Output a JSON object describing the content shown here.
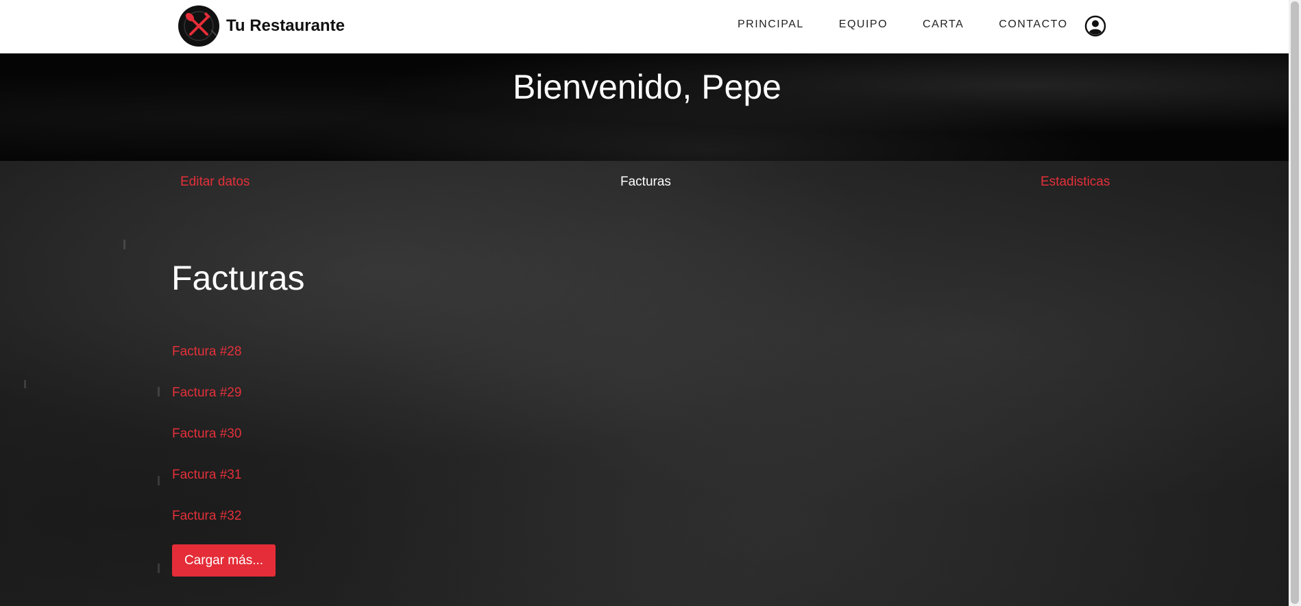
{
  "header": {
    "brand_name": "Tu Restaurante",
    "logo_icon": "crossed-fork-knife-logo",
    "nav": [
      {
        "label": "PRINCIPAL"
      },
      {
        "label": "EQUIPO"
      },
      {
        "label": "CARTA"
      },
      {
        "label": "CONTACTO"
      }
    ],
    "user_icon": "user-circle-icon"
  },
  "hero": {
    "title": "Bienvenido, Pepe"
  },
  "subnav": {
    "edit_label": "Editar datos",
    "invoices_label": "Facturas",
    "stats_label": "Estadisticas"
  },
  "invoices": {
    "title": "Facturas",
    "items": [
      {
        "label": "Factura #28"
      },
      {
        "label": "Factura #29"
      },
      {
        "label": "Factura #30"
      },
      {
        "label": "Factura #31"
      },
      {
        "label": "Factura #32"
      }
    ],
    "load_more_label": "Cargar más..."
  },
  "colors": {
    "accent": "#e42d38",
    "navbar_bg": "#ffffff",
    "board_bg": "#262626"
  }
}
